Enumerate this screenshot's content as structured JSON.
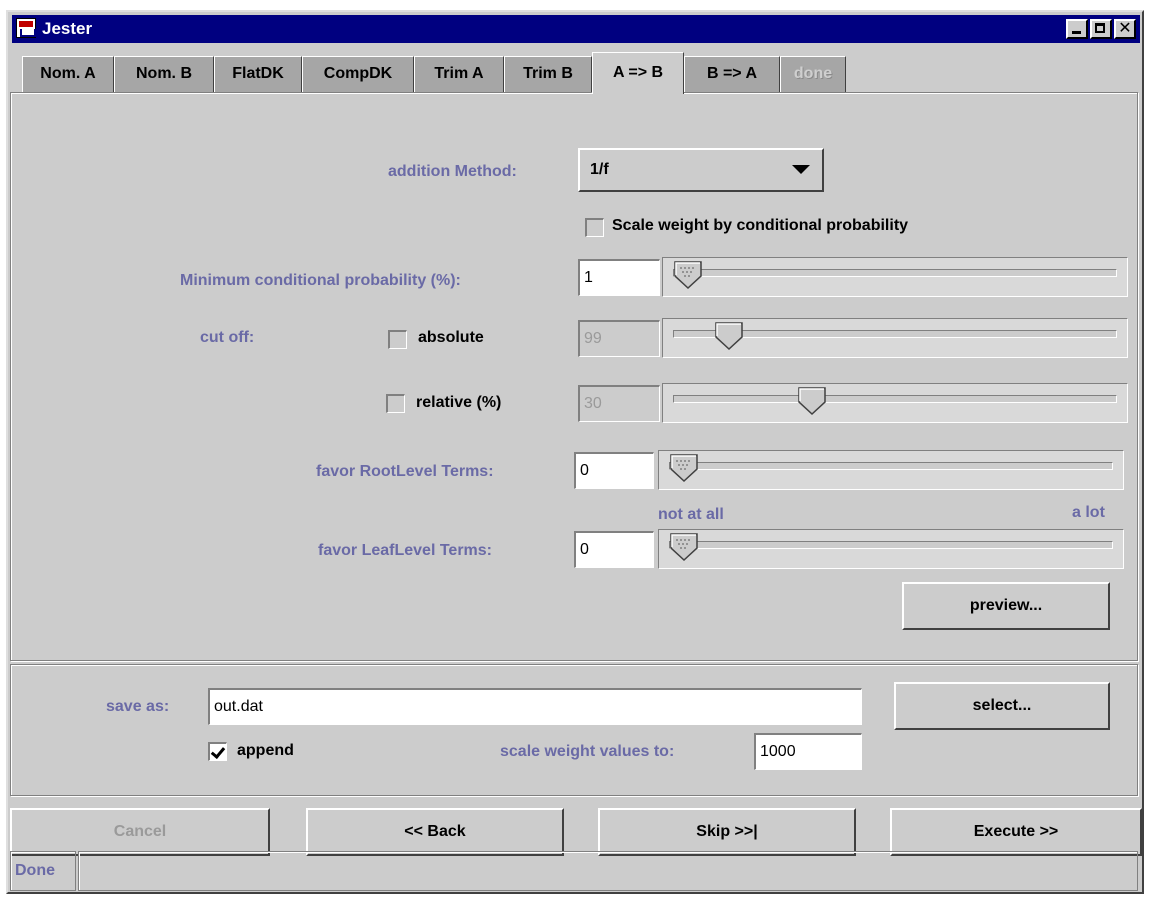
{
  "window": {
    "title": "Jester",
    "close_glyph": "✕"
  },
  "tabs": [
    {
      "label": "Nom. A",
      "active": false,
      "enabled": true
    },
    {
      "label": "Nom. B",
      "active": false,
      "enabled": true
    },
    {
      "label": "FlatDK",
      "active": false,
      "enabled": true
    },
    {
      "label": "CompDK",
      "active": false,
      "enabled": true
    },
    {
      "label": "Trim A",
      "active": false,
      "enabled": true
    },
    {
      "label": "Trim B",
      "active": false,
      "enabled": true
    },
    {
      "label": "A => B",
      "active": true,
      "enabled": true
    },
    {
      "label": "B => A",
      "active": false,
      "enabled": true
    },
    {
      "label": "done",
      "active": false,
      "enabled": false
    }
  ],
  "form": {
    "addition_method": {
      "label": "addition Method:",
      "value": "1/f"
    },
    "scale_by_cond_prob": {
      "label": "Scale weight by conditional probability",
      "checked": false
    },
    "min_cond_prob": {
      "label": "Minimum conditional probability (%):",
      "value": "1",
      "slider_fraction": 0.0
    },
    "cut_off": {
      "label": "cut off:",
      "absolute": {
        "label": "absolute",
        "checked": false,
        "value": "99",
        "slider_fraction": 0.1
      },
      "relative": {
        "label": "relative (%)",
        "checked": false,
        "value": "30",
        "slider_fraction": 0.3
      }
    },
    "favor_root": {
      "label": "favor RootLevel Terms:",
      "value": "0",
      "slider_fraction": 0.0
    },
    "scale_hint": {
      "min_label": "not at all",
      "max_label": "a lot"
    },
    "favor_leaf": {
      "label": "favor LeafLevel Terms:",
      "value": "0",
      "slider_fraction": 0.0
    },
    "preview_label": "preview..."
  },
  "output": {
    "save_as_label": "save as:",
    "save_as_value": "out.dat",
    "select_label": "select...",
    "append": {
      "label": "append",
      "checked": true
    },
    "scale_weight_label": "scale weight values to:",
    "scale_weight_value": "1000"
  },
  "buttons": {
    "cancel": "Cancel",
    "back": "<< Back",
    "skip": "Skip >>|",
    "execute": "Execute >>"
  },
  "status": "Done",
  "colors": {
    "title_bar": "#000080",
    "label_text": "#6a6aa6",
    "background": "#cccccc",
    "inactive_tab": "#a6a6a6"
  }
}
